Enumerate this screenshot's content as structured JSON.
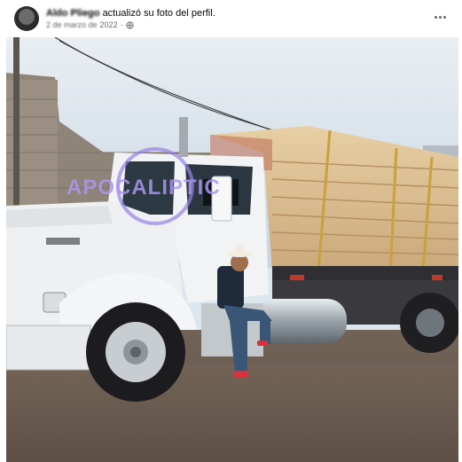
{
  "post": {
    "author_name": "Aldo Pliego",
    "action_text": "actualizó su foto del perfil.",
    "date_text": "2 de marzo de",
    "date_year": "2022",
    "separator": "·",
    "privacy_icon": "globe-icon",
    "more_icon": "more-options-icon"
  },
  "photo": {
    "watermark_text": "APOCALIPTIC"
  }
}
